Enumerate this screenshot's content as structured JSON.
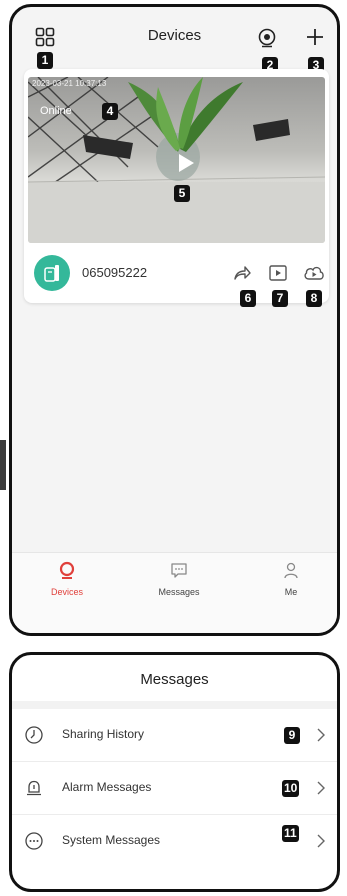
{
  "devices_screen": {
    "title": "Devices",
    "camera": {
      "timestamp": "2023-03-21 10:37:13",
      "status": "Online",
      "device_id": "065095222"
    },
    "tabs": [
      {
        "label": "Devices",
        "icon": "camera-tab-icon",
        "active": true
      },
      {
        "label": "Messages",
        "icon": "chat-icon",
        "active": false
      },
      {
        "label": "Me",
        "icon": "person-icon",
        "active": false
      }
    ],
    "badges": {
      "grid": "1",
      "scan": "2",
      "add": "3",
      "online": "4",
      "play": "5",
      "share": "6",
      "playback": "7",
      "cloud": "8"
    }
  },
  "messages_screen": {
    "title": "Messages",
    "items": [
      {
        "label": "Sharing History",
        "icon": "clock-icon",
        "badge": "9"
      },
      {
        "label": "Alarm Messages",
        "icon": "bell-icon",
        "badge": "10"
      },
      {
        "label": "System Messages",
        "icon": "chat-dots-icon",
        "badge": "11"
      }
    ]
  },
  "colors": {
    "accent": "#e0403b",
    "device_avatar": "#34b89a"
  }
}
